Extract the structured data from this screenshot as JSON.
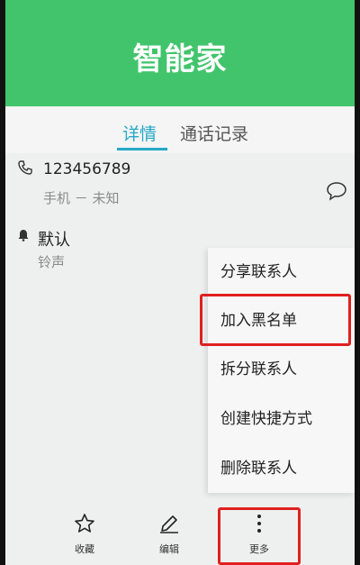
{
  "header": {
    "title": "智能家"
  },
  "tabs": [
    {
      "label": "详情",
      "active": true
    },
    {
      "label": "通话记录",
      "active": false
    }
  ],
  "contact": {
    "phone": "123456789",
    "phone_type": "手机 － 未知",
    "ringtone_value": "默认",
    "ringtone_label": "铃声"
  },
  "menu": {
    "items": [
      {
        "label": "分享联系人"
      },
      {
        "label": "加入黑名单"
      },
      {
        "label": "拆分联系人"
      },
      {
        "label": "创建快捷方式"
      },
      {
        "label": "删除联系人"
      }
    ]
  },
  "bottom_bar": {
    "favorite_label": "收藏",
    "edit_label": "编辑",
    "more_label": "更多"
  },
  "colors": {
    "header": "#42c46c",
    "tab_active": "#26a9c7",
    "highlight": "#e02020"
  }
}
